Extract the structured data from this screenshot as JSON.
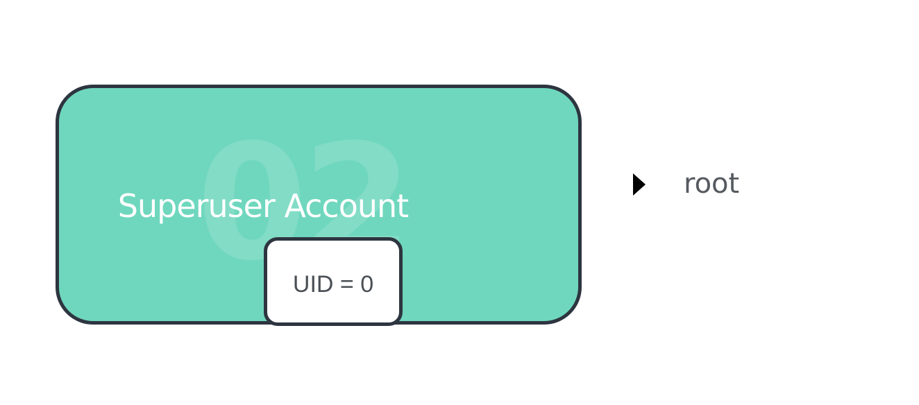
{
  "card": {
    "watermark": "02",
    "title": "Superuser Account",
    "uid_label": "UID = 0"
  },
  "bullet": {
    "label": "root",
    "icon": "triangle-right-icon"
  },
  "colors": {
    "card_fill": "#6fd7bd",
    "card_border": "#2d3540",
    "uid_box_fill": "#ffffff",
    "bullet": "#000000",
    "root_text": "#555a60"
  }
}
